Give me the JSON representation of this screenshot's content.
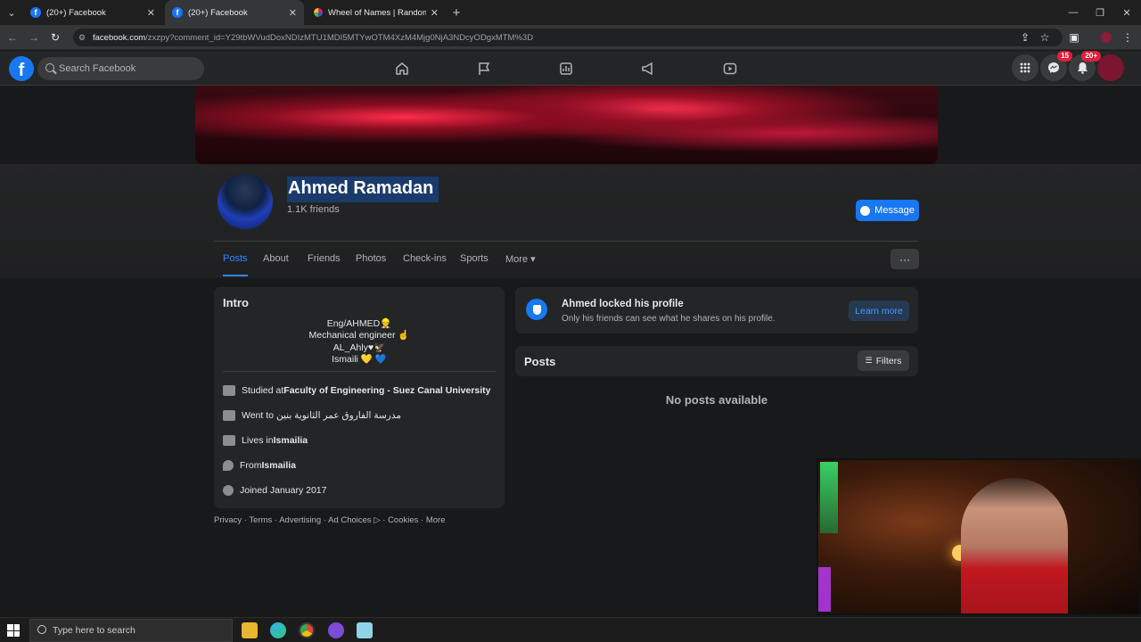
{
  "browser": {
    "tabs": [
      {
        "title": "(20+) Facebook",
        "active": false
      },
      {
        "title": "(20+) Facebook",
        "active": true
      },
      {
        "title": "Wheel of Names | Random nar",
        "active": false
      }
    ],
    "new_tab": "+",
    "url_domain": "facebook.com",
    "url_path": "/zxzpy?comment_id=Y29tbWVudDoxNDIzMTU1MDI5MTYwOTM4XzM4Mjg0NjA3NDcyODgxMTM%3D"
  },
  "facebook": {
    "logo": "f",
    "search_placeholder": "Search Facebook",
    "nav_icons": [
      "home-icon",
      "flag-icon",
      "chart-icon",
      "megaphone-icon",
      "video-icon"
    ],
    "messenger_badge": "15",
    "notifications_badge": "20+"
  },
  "profile": {
    "name": "Ahmed Ramadan",
    "friends": "1.1K friends",
    "message_button": "Message",
    "tabs": [
      "Posts",
      "About",
      "Friends",
      "Photos",
      "Check-ins",
      "Sports",
      "More ▾"
    ],
    "more_button": "···"
  },
  "intro": {
    "title": "Intro",
    "bio": [
      "Eng/AHMED👷",
      "Mechanical engineer ☝",
      "AL_Ahly♥🦅",
      "Ismaili 💛 💙"
    ],
    "details": [
      {
        "icon": "graduation-cap-icon",
        "prefix": "Studied at ",
        "value": "Faculty of Engineering - Suez Canal University",
        "bold": true
      },
      {
        "icon": "graduation-cap-icon",
        "prefix": "Went to ",
        "value": "مدرسة الفاروق عمر الثانوية بنين",
        "bold": false
      },
      {
        "icon": "home-icon",
        "prefix": "Lives in ",
        "value": "Ismailia",
        "bold": true
      },
      {
        "icon": "location-pin-icon",
        "prefix": "From ",
        "value": "Ismailia",
        "bold": true
      },
      {
        "icon": "clock-icon",
        "prefix": "Joined January 2017",
        "value": "",
        "bold": false
      }
    ]
  },
  "footer": "Privacy · Terms · Advertising · Ad Choices ▷ · Cookies · More",
  "locked": {
    "title": "Ahmed locked his profile",
    "subtitle": "Only his friends can see what he shares on his profile.",
    "button": "Learn more"
  },
  "posts": {
    "title": "Posts",
    "filters": "Filters",
    "empty": "No posts available"
  },
  "taskbar": {
    "search_placeholder": "Type here to search"
  },
  "colors": {
    "accent": "#1877f2",
    "selection": "#1a3a6b",
    "badge": "#e41e3f"
  }
}
